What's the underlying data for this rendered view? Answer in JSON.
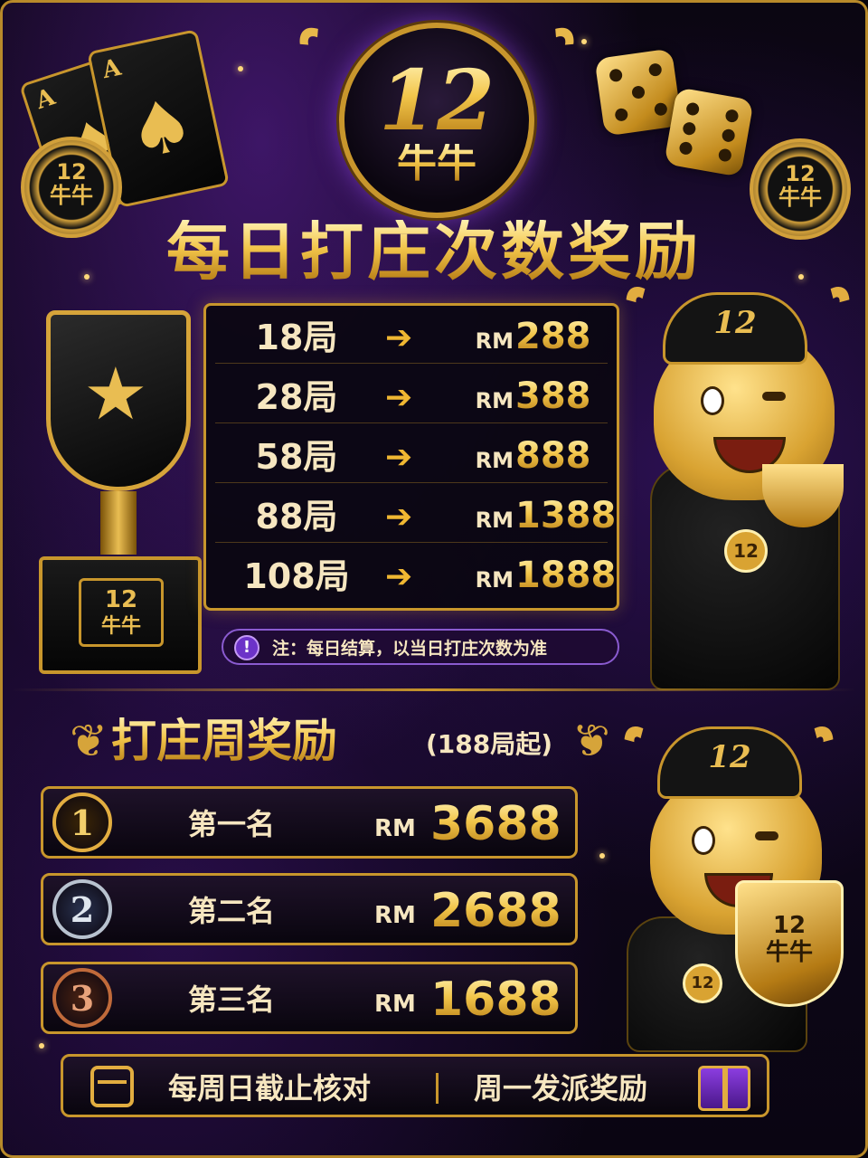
{
  "header": {
    "logo_number": "12",
    "logo_text": "牛牛",
    "card_rank": "A",
    "card_suit": "♠",
    "chip_text_number": "12",
    "chip_text_name": "牛牛"
  },
  "daily": {
    "title": "每日打庄次数奖励",
    "currency": "RM",
    "arrow": "➔",
    "rows": [
      {
        "games": "18局",
        "amount": "288"
      },
      {
        "games": "28局",
        "amount": "388"
      },
      {
        "games": "58局",
        "amount": "888"
      },
      {
        "games": "88局",
        "amount": "1388"
      },
      {
        "games": "108局",
        "amount": "1888"
      }
    ],
    "note_icon": "!",
    "note": "注：每日结算，以当日打庄次数为准"
  },
  "trophy": {
    "label_number": "12",
    "label_name": "牛牛"
  },
  "mascot": {
    "cap_text": "12",
    "medal_text": "12",
    "cup_number": "12",
    "cup_name": "牛牛"
  },
  "weekly": {
    "title": "打庄周奖励",
    "subtitle": "(188局起)",
    "currency": "RM",
    "ranks": [
      {
        "badge": "1",
        "name": "第一名",
        "amount": "3688"
      },
      {
        "badge": "2",
        "name": "第二名",
        "amount": "2688"
      },
      {
        "badge": "3",
        "name": "第三名",
        "amount": "1688"
      }
    ]
  },
  "footer": {
    "left_text": "每周日截止核对",
    "right_text": "周一发派奖励"
  },
  "icons": [
    "calendar-icon",
    "gift-icon",
    "info-icon",
    "arrow-right-icon",
    "laurel-icon",
    "star-icon",
    "spade-icon"
  ]
}
